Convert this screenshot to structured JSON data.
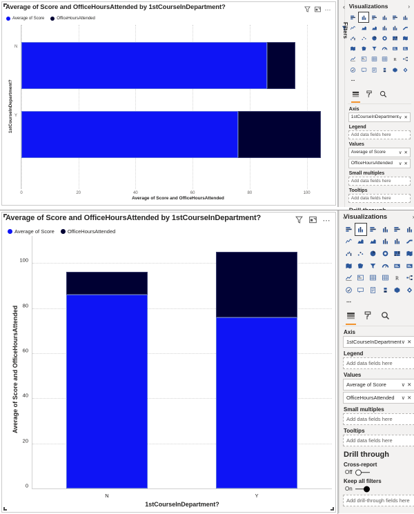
{
  "chart_data": [
    {
      "type": "bar",
      "orientation": "horizontal",
      "title": "Average of Score and OfficeHoursAttended by 1stCourseInDepartment?",
      "xlabel": "Average of Score and OfficeHoursAttended",
      "ylabel": "1stCourseInDepartment?",
      "categories": [
        "N",
        "Y"
      ],
      "series": [
        {
          "name": "Average of Score",
          "color": "#0e14f5",
          "values": [
            86,
            76
          ]
        },
        {
          "name": "OfficeHoursAttended",
          "color": "#000033",
          "values": [
            10,
            29
          ]
        }
      ],
      "totals": [
        96,
        105
      ],
      "xlim": [
        0,
        110
      ],
      "xticks": [
        0,
        20,
        40,
        60,
        80,
        100
      ],
      "grid": true,
      "legend_position": "top-left",
      "stacked": true
    },
    {
      "type": "bar",
      "orientation": "vertical",
      "title": "Average of Score and OfficeHoursAttended by 1stCourseInDepartment?",
      "xlabel": "1stCourseInDepartment?",
      "ylabel": "Average of Score and OfficeHoursAttended",
      "categories": [
        "N",
        "Y"
      ],
      "series": [
        {
          "name": "Average of Score",
          "color": "#0e14f5",
          "values": [
            86,
            76
          ]
        },
        {
          "name": "OfficeHoursAttended",
          "color": "#000033",
          "values": [
            10,
            29
          ]
        }
      ],
      "totals": [
        96,
        105
      ],
      "ylim": [
        0,
        112
      ],
      "yticks": [
        0,
        20,
        40,
        60,
        80,
        100
      ],
      "grid": true,
      "legend_position": "top-left",
      "stacked": true
    }
  ],
  "visual_header": {
    "filter_icon": "filter-funnel-icon",
    "focus_icon": "focus-mode-icon",
    "more_icon": "more-options-icon"
  },
  "panel": {
    "collapse_left_icon": "chevron-left-icon",
    "expand_right_icon": "chevron-right-icon",
    "filters_tab_label": "Filters",
    "filters_tab_icon": "filter-funnel-icon",
    "title": "Visualizations",
    "viz_types": [
      "stacked-bar-chart-icon",
      "stacked-column-chart-icon",
      "clustered-bar-chart-icon",
      "clustered-column-chart-icon",
      "100-stacked-bar-chart-icon",
      "100-stacked-column-chart-icon",
      "line-chart-icon",
      "area-chart-icon",
      "stacked-area-chart-icon",
      "line-stacked-column-chart-icon",
      "line-clustered-column-chart-icon",
      "ribbon-chart-icon",
      "waterfall-chart-icon",
      "scatter-chart-icon",
      "pie-chart-icon",
      "donut-chart-icon",
      "treemap-icon",
      "map-icon",
      "filled-map-icon",
      "shape-map-icon",
      "funnel-chart-icon",
      "gauge-chart-icon",
      "card-icon",
      "multi-row-card-icon",
      "kpi-icon",
      "slicer-icon",
      "table-icon",
      "matrix-icon",
      "r-script-visual-icon",
      "decomposition-tree-icon",
      "key-influencers-icon",
      "smart-narrative-icon",
      "paginated-report-icon",
      "python-visual-icon",
      "power-apps-icon",
      "power-automate-icon",
      "more-visuals-icon"
    ],
    "selected_viz": "stacked-column-chart-icon",
    "sub_tabs": [
      {
        "name": "fields-tab",
        "icon": "fields-icon",
        "active": true
      },
      {
        "name": "format-tab",
        "icon": "paint-roller-icon",
        "active": false
      },
      {
        "name": "analytics-tab",
        "icon": "magnifier-icon",
        "active": false
      }
    ],
    "wells": [
      {
        "label": "Axis",
        "chips": [
          {
            "name": "1stCourseInDepartment"
          }
        ],
        "placeholder": null
      },
      {
        "label": "Legend",
        "chips": [],
        "placeholder": "Add data fields here"
      },
      {
        "label": "Values",
        "chips": [
          {
            "name": "Average of Score"
          },
          {
            "name": "OfficeHoursAttended"
          }
        ],
        "placeholder": null
      },
      {
        "label": "Small multiples",
        "chips": [],
        "placeholder": "Add data fields here"
      },
      {
        "label": "Tooltips",
        "chips": [],
        "placeholder": "Add data fields here"
      }
    ],
    "chip_dropdown_icon": "chevron-down-icon",
    "chip_remove_icon": "close-icon",
    "drill_through": {
      "title": "Drill through",
      "cross_report": {
        "label": "Cross-report",
        "state": "Off",
        "on": false
      },
      "keep_all_filters": {
        "label": "Keep all filters",
        "state": "On",
        "on": true
      },
      "drop_zone": "Add drill-through fields here"
    }
  }
}
